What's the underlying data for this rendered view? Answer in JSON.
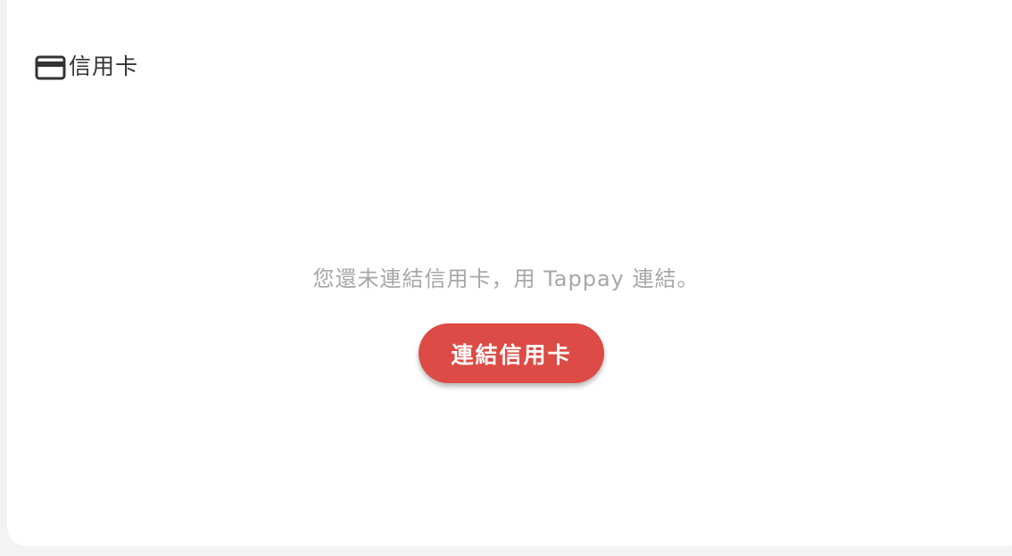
{
  "card": {
    "title": "信用卡",
    "icon": "credit-card-icon"
  },
  "empty_state": {
    "message": "您還未連結信用卡，用 Tappay 連結。",
    "button_label": "連結信用卡"
  },
  "colors": {
    "accent": "#dc4b45",
    "title_text": "#333333",
    "muted_text": "#a7a7a7",
    "card_bg": "#ffffff",
    "page_bg": "#f3f3f3"
  }
}
